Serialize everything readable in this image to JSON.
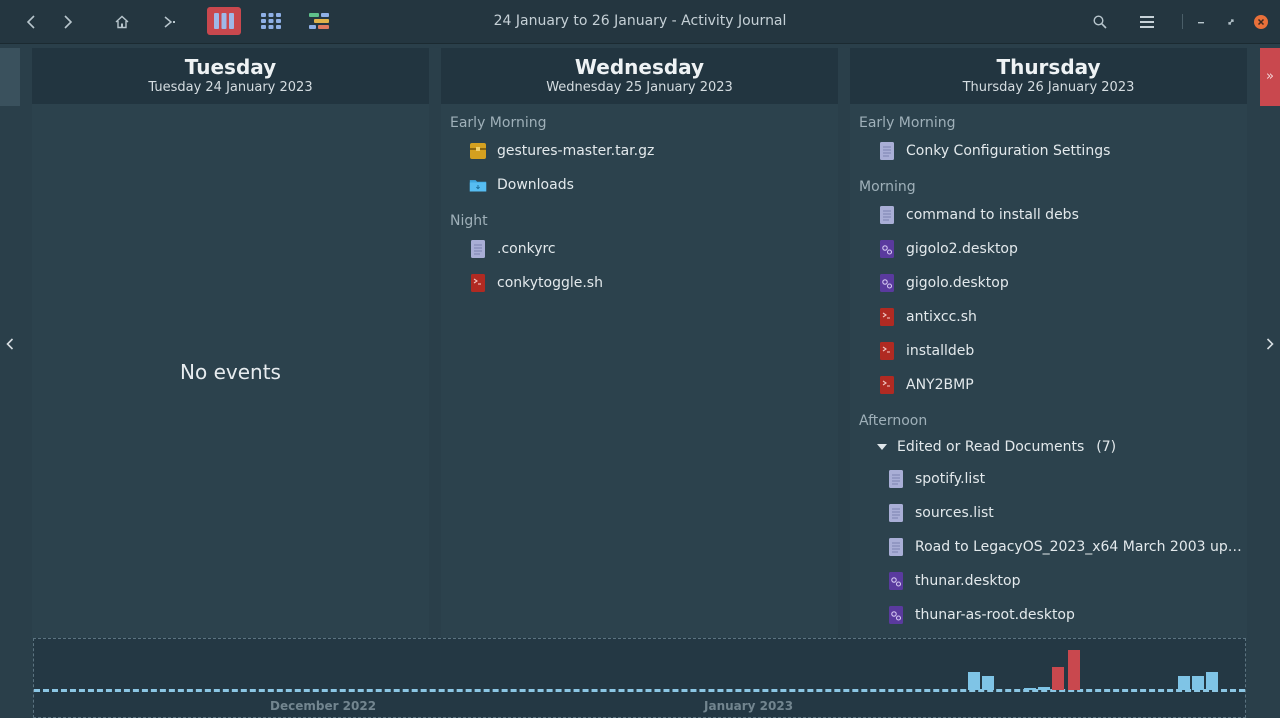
{
  "window": {
    "title": "24 January to 26 January - Activity Journal"
  },
  "toolbar": {
    "back": "back-icon",
    "forward": "forward-icon",
    "home": "home-icon",
    "go": "go-icon",
    "views": [
      "columns-view-icon",
      "grid-view-icon",
      "timeline-view-icon"
    ],
    "search": "search-icon",
    "menu": "menu-icon"
  },
  "days": [
    {
      "name": "Tuesday",
      "date": "Tuesday 24 January 2023",
      "empty_text": "No events"
    },
    {
      "name": "Wednesday",
      "date": "Wednesday 25 January 2023",
      "sections": [
        {
          "label": "Early Morning",
          "items": [
            {
              "name": "gestures-master.tar.gz",
              "icon": "archive-icon"
            },
            {
              "name": "Downloads",
              "icon": "folder-icon"
            }
          ]
        },
        {
          "label": "Night",
          "items": [
            {
              "name": ".conkyrc",
              "icon": "text-file-icon"
            },
            {
              "name": "conkytoggle.sh",
              "icon": "script-icon"
            }
          ]
        }
      ]
    },
    {
      "name": "Thursday",
      "date": "Thursday 26 January 2023",
      "sections": [
        {
          "label": "Early Morning",
          "items": [
            {
              "name": "Conky Configuration Settings",
              "icon": "text-file-icon"
            }
          ]
        },
        {
          "label": "Morning",
          "items": [
            {
              "name": "command to install debs",
              "icon": "text-file-icon"
            },
            {
              "name": "gigolo2.desktop",
              "icon": "desktop-file-icon"
            },
            {
              "name": "gigolo.desktop",
              "icon": "desktop-file-icon"
            },
            {
              "name": "antixcc.sh",
              "icon": "script-icon"
            },
            {
              "name": "installdeb",
              "icon": "script-icon"
            },
            {
              "name": "ANY2BMP",
              "icon": "script-icon"
            }
          ]
        },
        {
          "label": "Afternoon",
          "group": {
            "label": "Edited or Read Documents",
            "count": "(7)",
            "items": [
              {
                "name": "spotify.list",
                "icon": "text-file-icon"
              },
              {
                "name": "sources.list",
                "icon": "text-file-icon"
              },
              {
                "name": "Road to LegacyOS_2023_x64 March 2003 up…",
                "icon": "text-file-icon"
              },
              {
                "name": "thunar.desktop",
                "icon": "desktop-file-icon"
              },
              {
                "name": "thunar-as-root.desktop",
                "icon": "desktop-file-icon"
              }
            ]
          }
        }
      ]
    }
  ],
  "timeline": {
    "labels": [
      "December 2022",
      "January 2023"
    ],
    "colors": {
      "normal": "#7fc4e6",
      "selected": "#c9484e"
    },
    "bars": [
      {
        "level": 0.42,
        "selected": false
      },
      {
        "level": 0.33,
        "selected": false
      },
      {
        "level": 0.05,
        "selected": false
      },
      {
        "level": 0.08,
        "selected": false
      },
      {
        "level": 0.55,
        "selected": true
      },
      {
        "level": 0.95,
        "selected": true
      },
      {
        "level": 0.33,
        "selected": false
      },
      {
        "level": 0.33,
        "selected": false
      },
      {
        "level": 0.44,
        "selected": false
      }
    ]
  }
}
